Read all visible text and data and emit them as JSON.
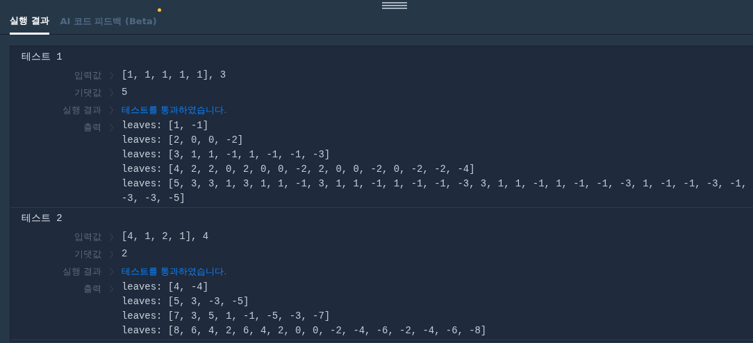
{
  "tabs": [
    {
      "label": "실행 결과",
      "selected": true,
      "badge": false
    },
    {
      "label": "AI 코드 피드백 (Beta)",
      "selected": false,
      "badge": true
    }
  ],
  "tests": [
    {
      "title": "테스트 1",
      "fields": [
        {
          "label": "입력값",
          "kind": "plain",
          "value": "[1, 1, 1, 1, 1], 3"
        },
        {
          "label": "기댓값",
          "kind": "plain",
          "value": "5"
        },
        {
          "label": "실행 결과",
          "kind": "pass",
          "value": "테스트를 통과하였습니다."
        }
      ],
      "output_label": "출력",
      "output": [
        "leaves: [1, -1]",
        "leaves: [2, 0, 0, -2]",
        "leaves: [3, 1, 1, -1, 1, -1, -1, -3]",
        "leaves: [4, 2, 2, 0, 2, 0, 0, -2, 2, 0, 0, -2, 0, -2, -2, -4]",
        "leaves: [5, 3, 3, 1, 3, 1, 1, -1, 3, 1, 1, -1, 1, -1, -1, -3, 3, 1, 1, -1, 1, -1, -1, -3, 1, -1, -1, -3, -1,",
        "-3, -3, -5]"
      ]
    },
    {
      "title": "테스트 2",
      "fields": [
        {
          "label": "입력값",
          "kind": "plain",
          "value": "[4, 1, 2, 1], 4"
        },
        {
          "label": "기댓값",
          "kind": "plain",
          "value": "2"
        },
        {
          "label": "실행 결과",
          "kind": "pass",
          "value": "테스트를 통과하였습니다."
        }
      ],
      "output_label": "출력",
      "output": [
        "leaves: [4, -4]",
        "leaves: [5, 3, -3, -5]",
        "leaves: [7, 3, 5, 1, -1, -5, -3, -7]",
        "leaves: [8, 6, 4, 2, 6, 4, 2, 0, 0, -2, -4, -6, -2, -4, -6, -8]"
      ]
    }
  ]
}
